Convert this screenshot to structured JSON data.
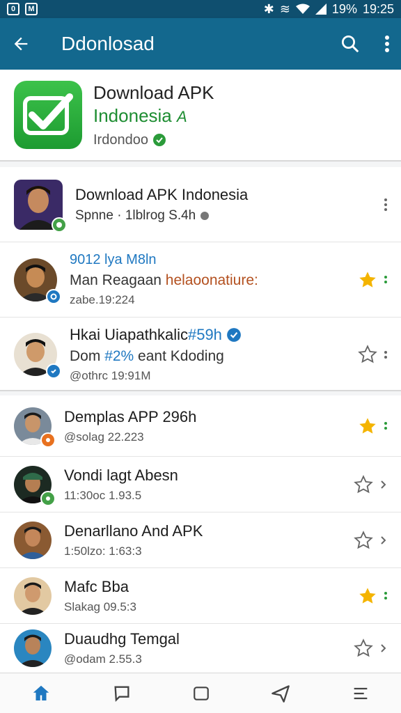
{
  "status": {
    "percent": "19%",
    "time": "19:25"
  },
  "appbar": {
    "title": "Ddonlosad"
  },
  "app": {
    "name_line1": "Download APK",
    "name_line2": "Indonesia",
    "name_suffix": "A",
    "publisher": "Irdondoo"
  },
  "colors": {
    "appbar": "#13688e",
    "green": "#2b9b3a",
    "star": "#f4b400",
    "link": "#1f78c1"
  },
  "section1": [
    {
      "line1": "Download APK Indonesia",
      "line2": "Spnne · 1lblrog S.4h",
      "badge": "green",
      "starred": null,
      "skin": "#c58a5f",
      "bg": "#3a2a66"
    },
    {
      "line1": "9012 lya M8ln",
      "line2a": "Man Reagaan ",
      "line2b": "helaoonatiure:",
      "line3": "zabe.19:224",
      "badge": "blue",
      "starred": true,
      "skin": "#c68b55",
      "bg": "#6b4a2a"
    },
    {
      "line1a": "Hkai Uiapathkalic ",
      "line1b": "#59h",
      "line2a": "Dom ",
      "line2b": "#2%",
      "line2c": " eant Kdoding",
      "line3": "@othrc 19:91M",
      "badge": "blue",
      "starred": false,
      "skin": "#cf9a6a",
      "bg": "#e8e0d2"
    }
  ],
  "section2": [
    {
      "line1": "Demplas APP 296h",
      "line2": "@solag 22.223",
      "badge": "orange",
      "starred": true,
      "skin": "#c8956a",
      "bg": "#7a8a9a"
    },
    {
      "line1": "Vondi lagt Abesn",
      "line2": "11:30oc 1.93.5",
      "badge": "green",
      "starred": false,
      "skin": "#b57e52",
      "bg": "#1c2a22"
    },
    {
      "line1": "Denarllano And APK",
      "line2": "1:50lzo: 1:63:3",
      "badge": null,
      "starred": false,
      "skin": "#c4875a",
      "bg": "#8a5a32"
    },
    {
      "line1": "Mafc Bba",
      "line2": "Slakag 09.5:3",
      "badge": null,
      "starred": true,
      "skin": "#cf9a6e",
      "bg": "#e2c9a2"
    },
    {
      "line1": "Duaudhg Temgal",
      "line2": "@odam 2.55.3",
      "badge": null,
      "starred": false,
      "skin": "#b8835a",
      "bg": "#2a86c0"
    }
  ],
  "nav": [
    "home-icon",
    "chat-icon",
    "square-icon",
    "send-icon",
    "menu-icon"
  ]
}
